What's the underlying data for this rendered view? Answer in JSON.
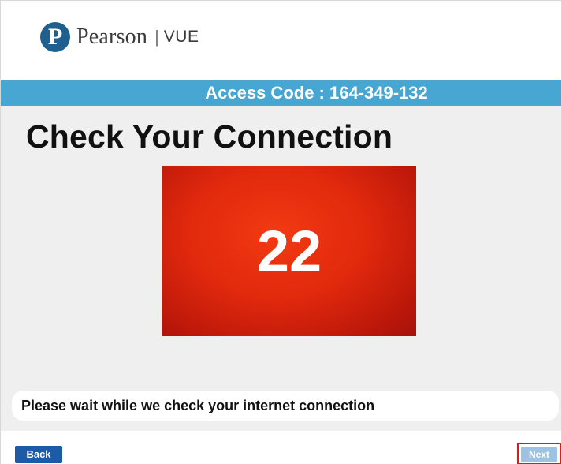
{
  "header": {
    "logo_mark": "P",
    "brand_name": "Pearson",
    "separator": "|",
    "product_name": "VUE"
  },
  "access_bar": {
    "text": "Access Code : 164-349-132"
  },
  "main": {
    "title": "Check Your Connection",
    "countdown_value": "22",
    "status_message": "Please wait while we check your internet connection"
  },
  "footer": {
    "back_label": "Back",
    "next_label": "Next",
    "next_enabled": false
  },
  "colors": {
    "access_bar": "#47a6d2",
    "countdown_bg": "#e1290d",
    "back_button": "#1d5aa8",
    "next_button_disabled": "#9cc3e4",
    "next_highlight_border": "#e01818",
    "content_bg": "#efefef",
    "logo_mark": "#1e5f8e"
  }
}
